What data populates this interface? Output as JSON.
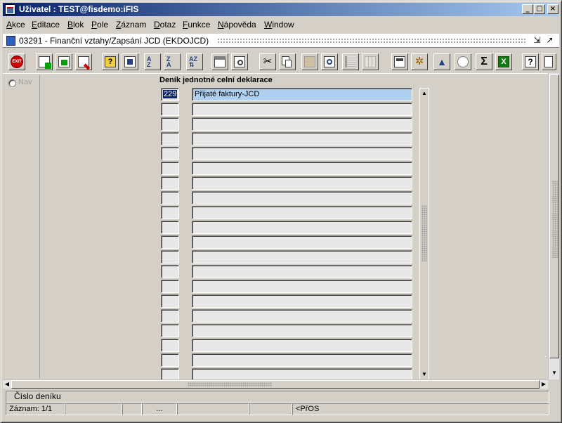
{
  "window": {
    "title": "Uživatel : TEST@fisdemo:iFIS",
    "minimize": "_",
    "maximize": "□",
    "close": "×"
  },
  "menu": [
    "Akce",
    "Editace",
    "Blok",
    "Pole",
    "Záznam",
    "Dotaz",
    "Funkce",
    "Nápověda",
    "Window"
  ],
  "document": {
    "title": "03291 - Finanční vztahy/Zapsání JCD (EKDOJCD)"
  },
  "toolbar": {
    "exit_label": "EXIT",
    "icons": [
      "exit-icon",
      "insert-record-icon",
      "save-icon",
      "delete-record-icon",
      "query-icon",
      "execute-query-icon",
      "sort-ascending-icon",
      "sort-descending-icon",
      "sort-multiple-icon",
      "print-icon",
      "print-preview-icon",
      "cut-icon",
      "copy-icon",
      "paste-icon",
      "search-icon",
      "list-icon",
      "columns-icon",
      "calculator-icon",
      "settings-icon",
      "navigate-icon",
      "clock-icon",
      "sum-icon",
      "excel-icon",
      "help-icon",
      "extra-icon"
    ]
  },
  "nav": {
    "label": "Nav"
  },
  "block": {
    "title": "Deník jednotné celní deklarace",
    "rows": [
      {
        "num": "229",
        "name": "Přijaté faktury-JCD"
      },
      {
        "num": "",
        "name": ""
      },
      {
        "num": "",
        "name": ""
      },
      {
        "num": "",
        "name": ""
      },
      {
        "num": "",
        "name": ""
      },
      {
        "num": "",
        "name": ""
      },
      {
        "num": "",
        "name": ""
      },
      {
        "num": "",
        "name": ""
      },
      {
        "num": "",
        "name": ""
      },
      {
        "num": "",
        "name": ""
      },
      {
        "num": "",
        "name": ""
      },
      {
        "num": "",
        "name": ""
      },
      {
        "num": "",
        "name": ""
      },
      {
        "num": "",
        "name": ""
      },
      {
        "num": "",
        "name": ""
      },
      {
        "num": "",
        "name": ""
      },
      {
        "num": "",
        "name": ""
      },
      {
        "num": "",
        "name": ""
      },
      {
        "num": "",
        "name": ""
      },
      {
        "num": "",
        "name": ""
      }
    ]
  },
  "hint": "Číslo deníku",
  "status": {
    "record": "Záznam: 1/1",
    "ellipsis": "...",
    "mode": "<PřOS"
  }
}
